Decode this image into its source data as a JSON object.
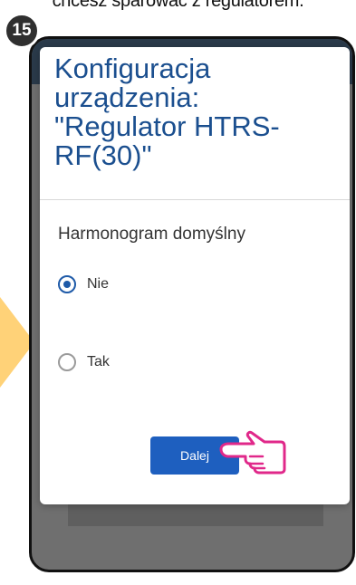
{
  "caption": {
    "text": "chcesz sparować z regulatorem."
  },
  "step": {
    "number": "15"
  },
  "dialog": {
    "title": "Konfiguracja urządzenia: \"Regulator HTRS-RF(30)\"",
    "section_label": "Harmonogram domyślny",
    "options": [
      {
        "label": "Nie",
        "selected": true
      },
      {
        "label": "Tak",
        "selected": false
      }
    ],
    "next_button_label": "Dalej"
  },
  "colors": {
    "accent": "#1e5fbf",
    "title": "#1b4f8f",
    "badge": "#2f2f2f",
    "arrow": "#ffd278",
    "hand": "#e0288a"
  },
  "icons": {
    "pointer": "pointing-hand-icon"
  }
}
